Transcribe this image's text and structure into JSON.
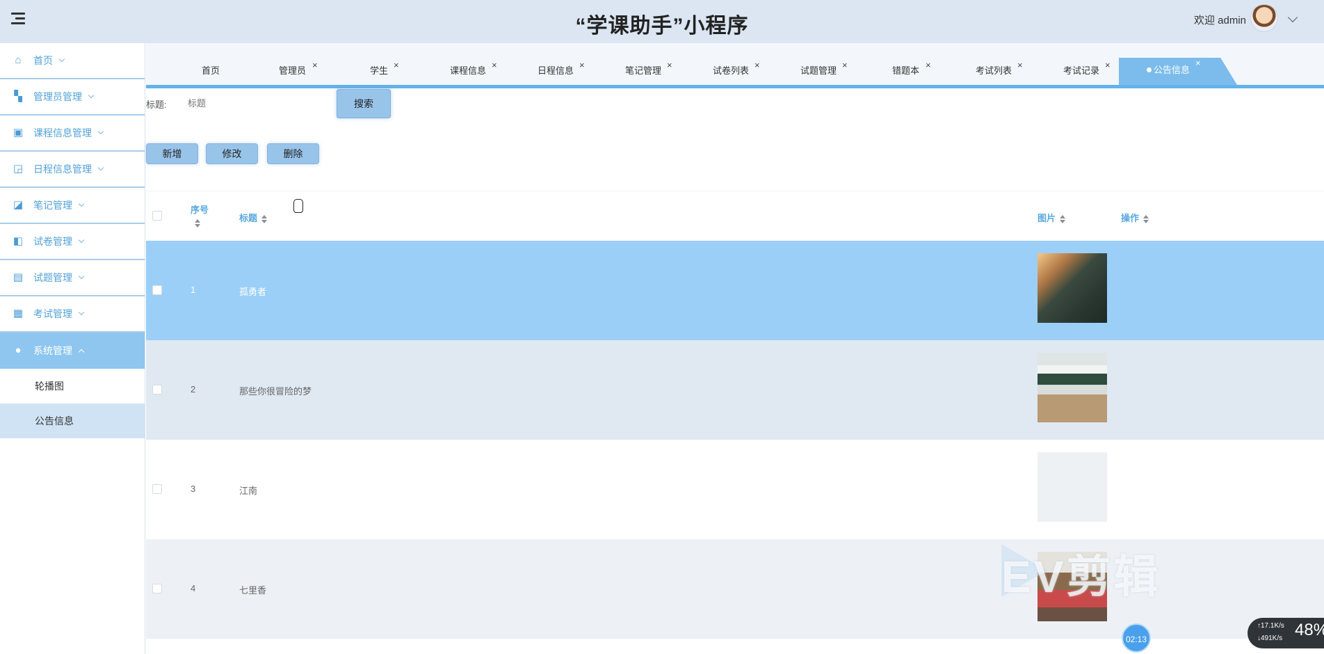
{
  "header": {
    "title": "“学课助手”小程序",
    "welcome": "欢迎 admin"
  },
  "sidebar": {
    "items": [
      {
        "label": "首页",
        "icon": "home-icon"
      },
      {
        "label": "管理员管理",
        "icon": "apps-icon"
      },
      {
        "label": "课程信息管理",
        "icon": "contact-icon"
      },
      {
        "label": "日程信息管理",
        "icon": "crop-icon"
      },
      {
        "label": "笔记管理",
        "icon": "note-icon"
      },
      {
        "label": "试卷管理",
        "icon": "layout-icon"
      },
      {
        "label": "试题管理",
        "icon": "briefcase-icon"
      },
      {
        "label": "考试管理",
        "icon": "grid-icon"
      },
      {
        "label": "系统管理",
        "icon": "drop-icon"
      }
    ],
    "subitems": [
      {
        "label": "轮播图"
      },
      {
        "label": "公告信息"
      }
    ]
  },
  "tabs": [
    {
      "label": "首页"
    },
    {
      "label": "管理员"
    },
    {
      "label": "学生"
    },
    {
      "label": "课程信息"
    },
    {
      "label": "日程信息"
    },
    {
      "label": "笔记管理"
    },
    {
      "label": "试卷列表"
    },
    {
      "label": "试题管理"
    },
    {
      "label": "错题本"
    },
    {
      "label": "考试列表"
    },
    {
      "label": "考试记录"
    },
    {
      "label": "公告信息"
    }
  ],
  "search": {
    "label": "标题:",
    "placeholder": "标题",
    "button": "搜索"
  },
  "actions": {
    "add": "新增",
    "edit": "修改",
    "delete": "删除"
  },
  "table": {
    "headers": {
      "index": "序号",
      "title": "标题",
      "image": "图片",
      "operation": "操作"
    },
    "rows": [
      {
        "index": "1",
        "title": "孤勇者"
      },
      {
        "index": "2",
        "title": "那些你很冒险的梦"
      },
      {
        "index": "3",
        "title": "江南"
      },
      {
        "index": "4",
        "title": "七里香"
      }
    ]
  },
  "overlay": {
    "watermark": "EV剪辑",
    "timer": "02:13",
    "net_up": "↑17.1K/s",
    "net_down": "↓491K/s",
    "cpu": "48%"
  },
  "colors": {
    "header_bg": "#dbe6f2",
    "accent": "#62b2ec",
    "selected_row": "#9bcff8"
  }
}
